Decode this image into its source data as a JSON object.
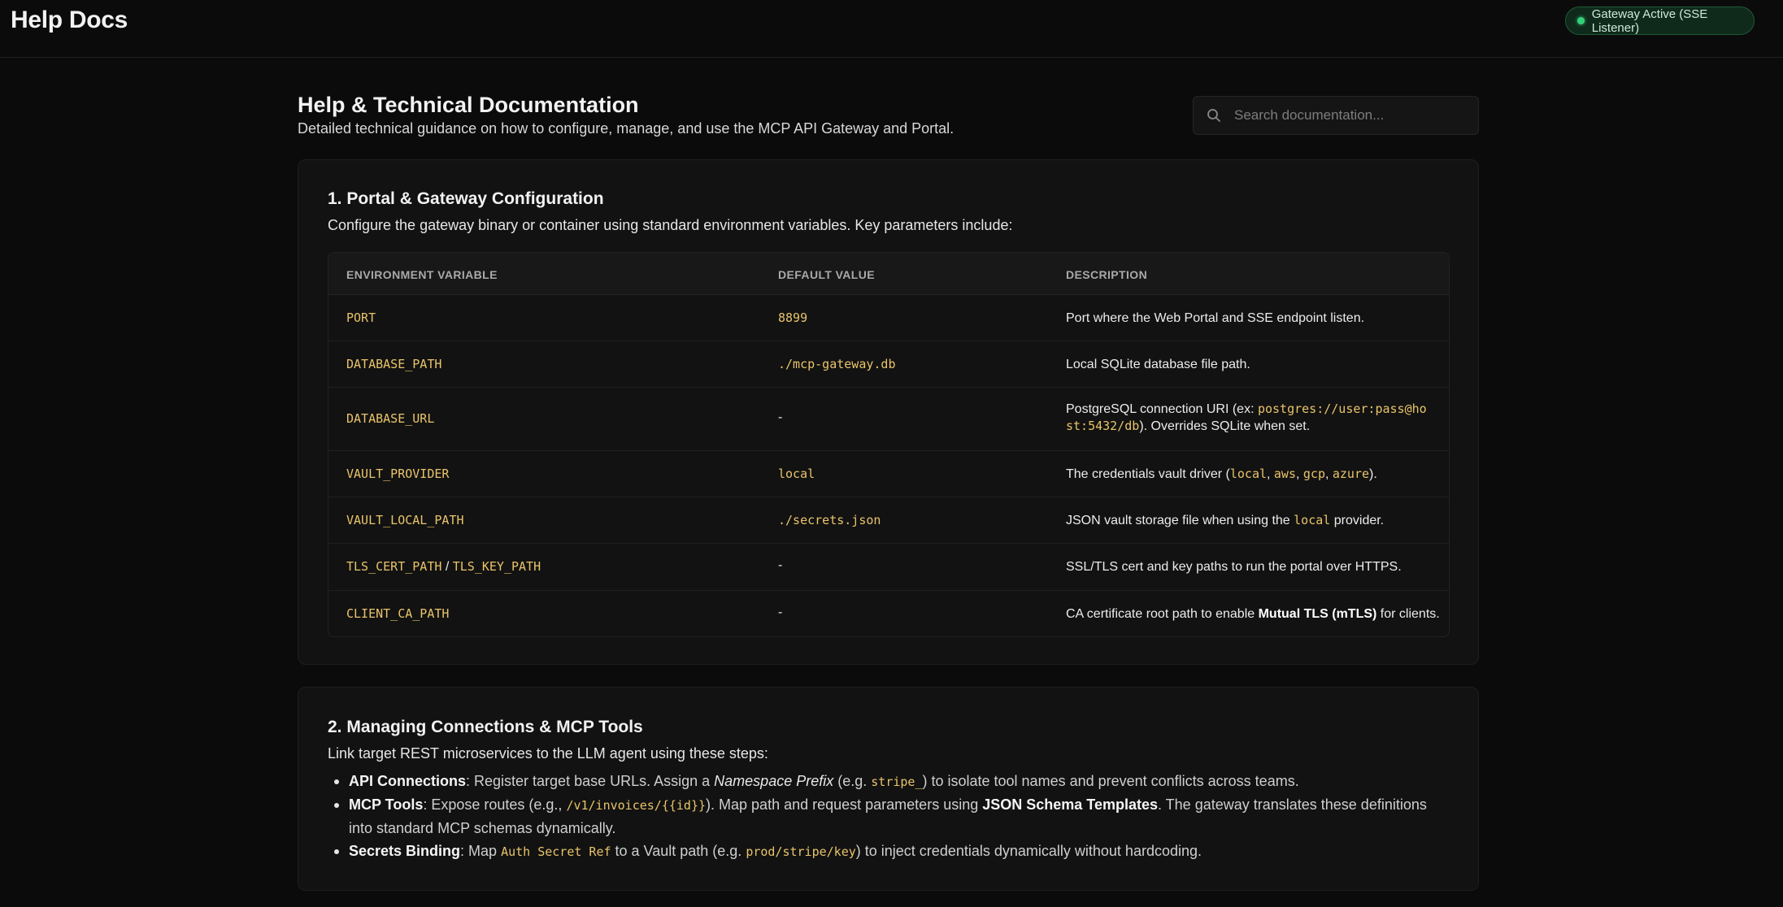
{
  "header": {
    "brand": "Help Docs",
    "status": "Gateway Active (SSE Listener)",
    "status_color": "#33d17a"
  },
  "page": {
    "title": "Help & Technical Documentation",
    "subtitle": "Detailed technical guidance on how to configure, manage, and use the MCP API Gateway and Portal."
  },
  "search": {
    "placeholder": "Search documentation...",
    "icon": "search-icon"
  },
  "section1": {
    "title": "1. Portal & Gateway Configuration",
    "intro": "Configure the gateway binary or container using standard environment variables. Key parameters include:",
    "columns": [
      "ENVIRONMENT VARIABLE",
      "DEFAULT VALUE",
      "DESCRIPTION"
    ],
    "rows": [
      {
        "var": "PORT",
        "default": "8899",
        "desc": "Port where the Web Portal and SSE endpoint listen."
      },
      {
        "var": "DATABASE_PATH",
        "default": "./mcp-gateway.db",
        "desc": "Local SQLite database file path."
      },
      {
        "var": "DATABASE_URL",
        "default": "-",
        "desc_pre": "PostgreSQL connection URI (ex: ",
        "desc_code1": "postgres://user:pass@ho",
        "desc_code2": "st:5432/db",
        "desc_post": "). Overrides SQLite when set."
      },
      {
        "var": "VAULT_PROVIDER",
        "default": "local",
        "desc_pre": "The credentials vault driver (",
        "desc_codes": [
          "local",
          "aws",
          "gcp",
          "azure"
        ],
        "desc_sep": ", ",
        "desc_post": ")."
      },
      {
        "var": "VAULT_LOCAL_PATH",
        "default": "./secrets.json",
        "desc_pre": "JSON vault storage file when using the ",
        "desc_code": "local",
        "desc_post": " provider."
      },
      {
        "var1": "TLS_CERT_PATH",
        "var_sep": " / ",
        "var2": "TLS_KEY_PATH",
        "default": "-",
        "desc": "SSL/TLS cert and key paths to run the portal over HTTPS."
      },
      {
        "var": "CLIENT_CA_PATH",
        "default": "-",
        "desc_pre": "CA certificate root path to enable ",
        "desc_bold": "Mutual TLS (mTLS)",
        "desc_post": " for clients."
      }
    ]
  },
  "section2": {
    "title": "2. Managing Connections & MCP Tools",
    "intro": "Link target REST microservices to the LLM agent using these steps:",
    "items": [
      {
        "label": "API Connections",
        "t1": ": Register target base URLs. Assign a ",
        "em": "Namespace Prefix",
        "t2": " (e.g. ",
        "code": "stripe_",
        "t3": ") to isolate tool names and prevent conflicts across teams."
      },
      {
        "label": "MCP Tools",
        "t1": ": Expose routes (e.g., ",
        "code": "/v1/invoices/{{id}}",
        "t2": "). Map path and request parameters using ",
        "bold": "JSON Schema Templates",
        "t3": ". The gateway translates these definitions into standard MCP schemas dynamically."
      },
      {
        "label": "Secrets Binding",
        "t1": ": Map ",
        "code": "Auth Secret Ref",
        "t2": " to a Vault path (e.g. ",
        "code2": "prod/stripe/key",
        "t3": ") to inject credentials dynamically without hardcoding."
      }
    ]
  }
}
